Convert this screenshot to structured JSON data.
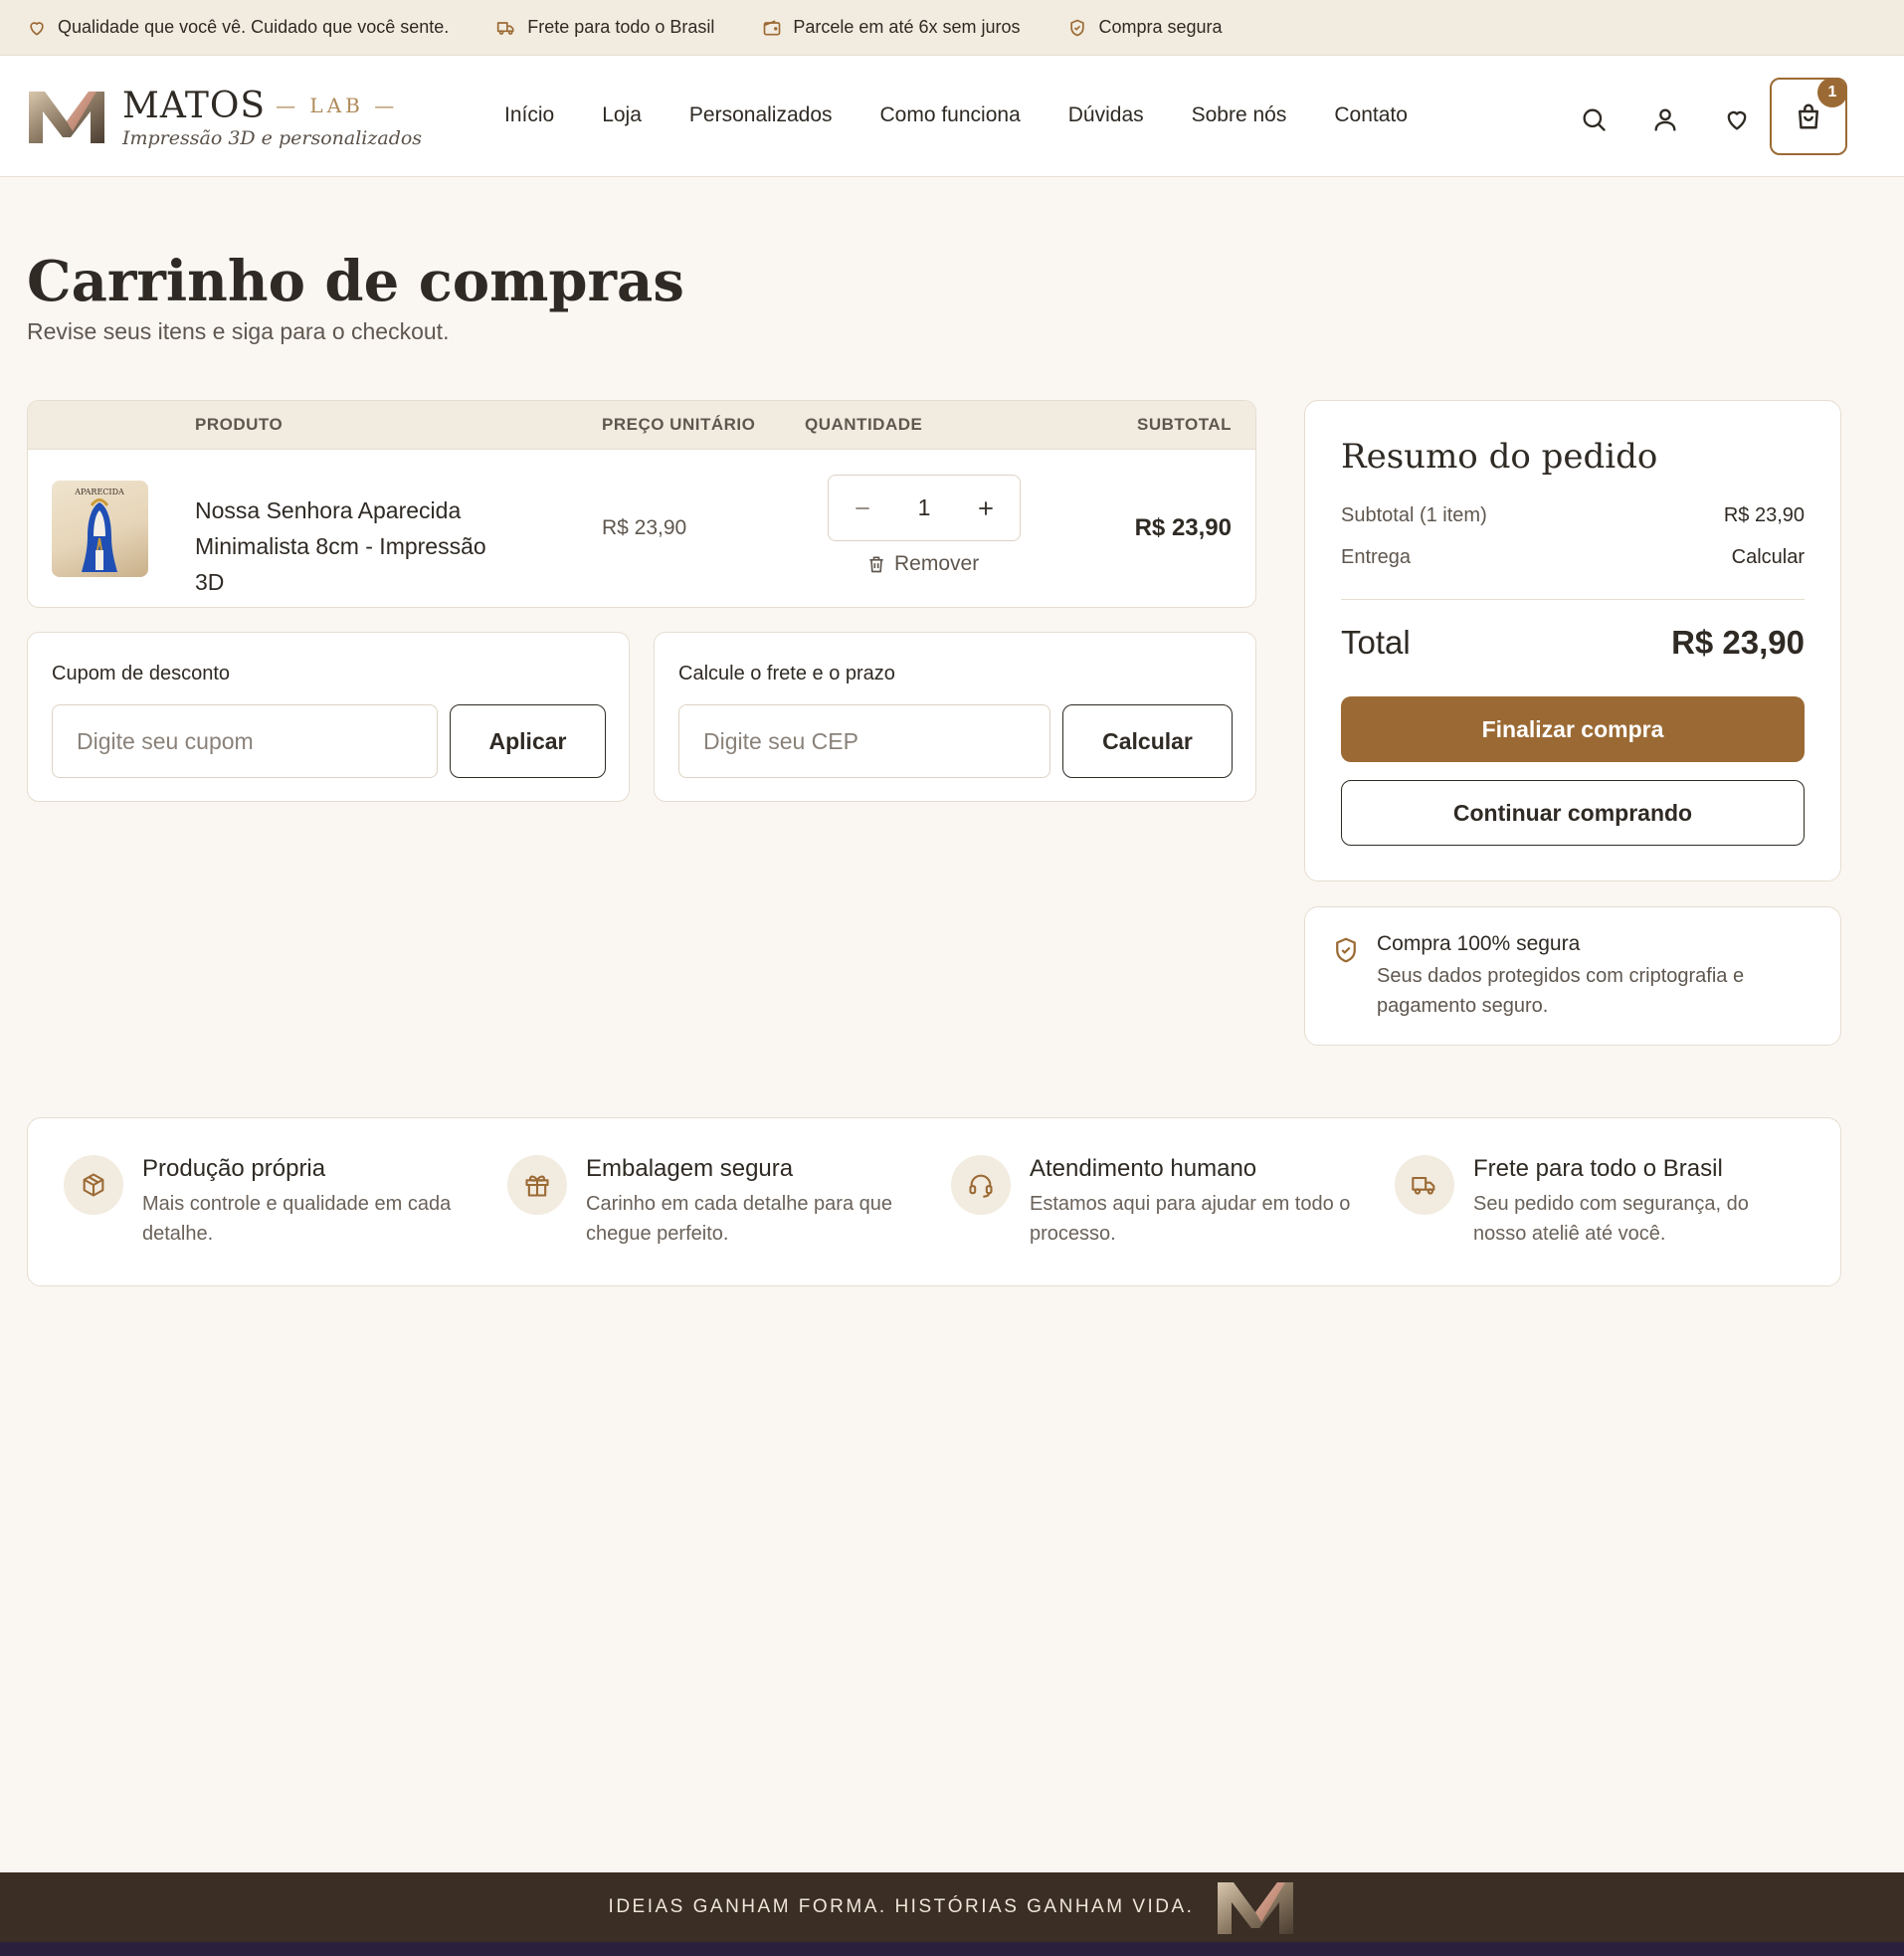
{
  "topbar": {
    "items": [
      {
        "icon": "heart-icon",
        "text": "Qualidade que você vê. Cuidado que você sente."
      },
      {
        "icon": "truck-icon",
        "text": "Frete para todo o Brasil"
      },
      {
        "icon": "wallet-icon",
        "text": "Parcele em até 6x sem juros"
      },
      {
        "icon": "shield-check-icon",
        "text": "Compra segura"
      }
    ]
  },
  "header": {
    "brand": "MATOS",
    "brand_sub": "— LAB —",
    "tagline": "Impressão 3D e personalizados",
    "nav": [
      "Início",
      "Loja",
      "Personalizados",
      "Como funciona",
      "Dúvidas",
      "Sobre nós",
      "Contato"
    ],
    "cart_count": "1"
  },
  "page": {
    "title": "Carrinho de compras",
    "subtitle": "Revise seus itens e siga para o checkout."
  },
  "cart": {
    "columns": {
      "product": "PRODUTO",
      "unit_price": "PREÇO UNITÁRIO",
      "quantity": "QUANTIDADE",
      "subtotal": "SUBTOTAL"
    },
    "items": [
      {
        "name": "Nossa Senhora Aparecida Minimalista 8cm - Impressão 3D",
        "thumb_text": "APARECIDA",
        "unit_price": "R$ 23,90",
        "quantity": "1",
        "subtotal": "R$ 23,90",
        "remove_label": "Remover"
      }
    ]
  },
  "coupon": {
    "label": "Cupom de desconto",
    "placeholder": "Digite seu cupom",
    "button": "Aplicar"
  },
  "shipping": {
    "label": "Calcule o frete e o prazo",
    "placeholder": "Digite seu CEP",
    "button": "Calcular"
  },
  "summary": {
    "title": "Resumo do pedido",
    "subtotal_label": "Subtotal (1 item)",
    "subtotal_value": "R$ 23,90",
    "delivery_label": "Entrega",
    "delivery_value": "Calcular",
    "total_label": "Total",
    "total_value": "R$ 23,90",
    "checkout_button": "Finalizar compra",
    "continue_button": "Continuar comprando"
  },
  "secure": {
    "title": "Compra 100% segura",
    "text": "Seus dados protegidos com criptografia e pagamento seguro."
  },
  "features": [
    {
      "icon": "box-icon",
      "title": "Produção própria",
      "text": "Mais controle e qualidade em cada detalhe."
    },
    {
      "icon": "gift-icon",
      "title": "Embalagem segura",
      "text": "Carinho em cada detalhe para que chegue perfeito."
    },
    {
      "icon": "headset-icon",
      "title": "Atendimento humano",
      "text": "Estamos aqui para ajudar em todo o processo."
    },
    {
      "icon": "truck-icon",
      "title": "Frete para todo o Brasil",
      "text": "Seu pedido com segurança, do nosso ateliê até você."
    }
  ],
  "footer": {
    "slogan": "IDEIAS GANHAM FORMA. HISTÓRIAS GANHAM VIDA."
  },
  "colors": {
    "accent": "#9b6a34",
    "background": "#faf7f2",
    "topbar": "#f2ebdf",
    "footer": "#3a2e25",
    "text": "#2f2a24"
  }
}
